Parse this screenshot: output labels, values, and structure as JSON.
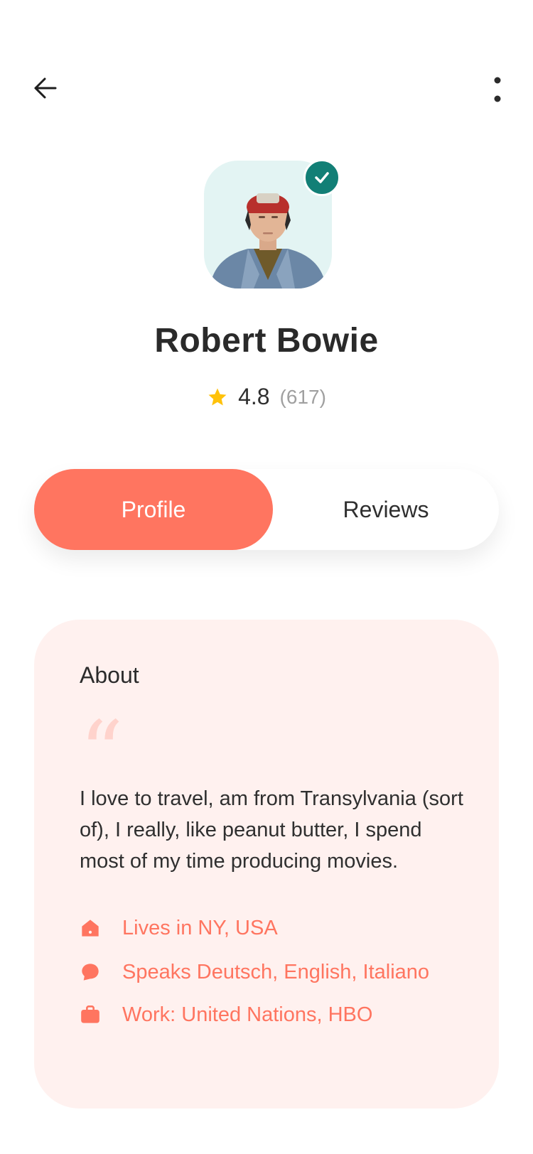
{
  "header": {
    "back_icon": "arrow-left-icon",
    "more_icon": "more-vertical-icon"
  },
  "profile": {
    "name": "Robert Bowie",
    "verified": true,
    "rating": "4.8",
    "review_count": "(617)"
  },
  "tabs": [
    {
      "label": "Profile",
      "active": true
    },
    {
      "label": "Reviews",
      "active": false
    }
  ],
  "about": {
    "title": "About",
    "quote_mark": "“",
    "text": "I love to travel, am from Transylvania (sort of), I really, like peanut butter, I spend most of my time producing movies.",
    "facts": [
      {
        "icon": "home-icon",
        "text": "Lives in NY, USA"
      },
      {
        "icon": "chat-bubble-icon",
        "text": "Speaks Deutsch, English, Italiano"
      },
      {
        "icon": "briefcase-icon",
        "text": "Work: United Nations, HBO"
      }
    ]
  },
  "colors": {
    "accent": "#ff7560",
    "verified": "#127f76",
    "star": "#ffc20a",
    "card_bg": "#fff1ef"
  }
}
